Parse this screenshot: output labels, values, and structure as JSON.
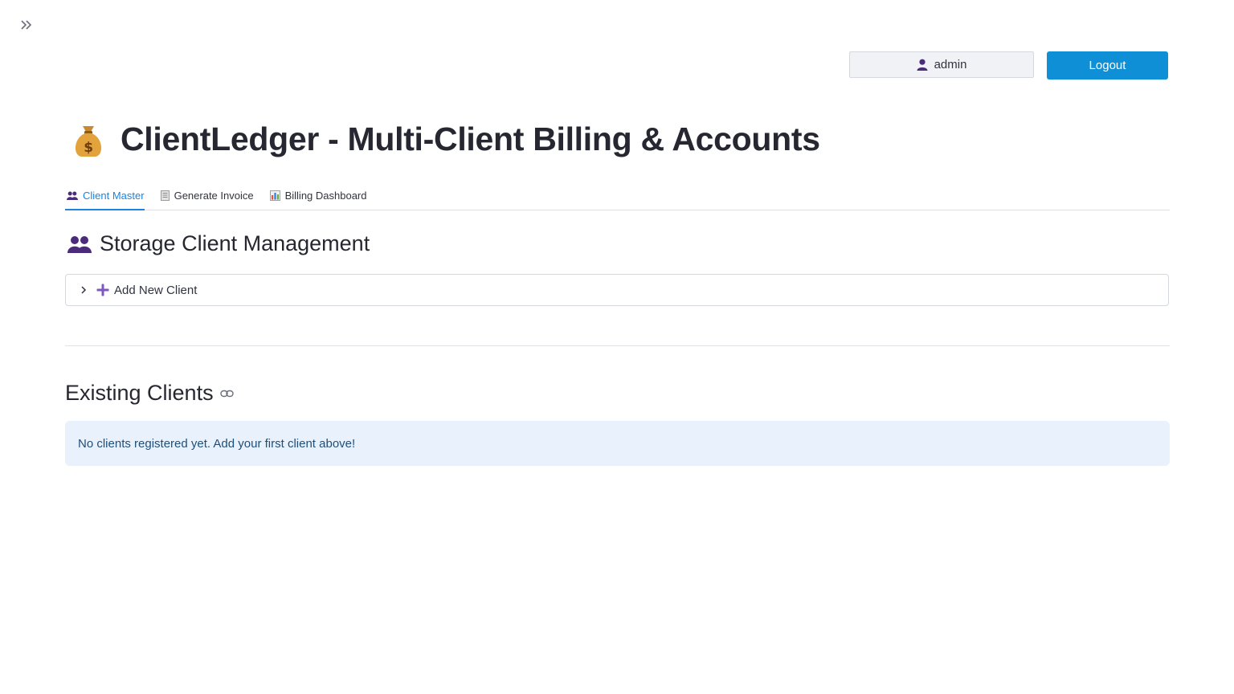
{
  "header": {
    "user": {
      "icon": "user-icon",
      "username": "admin"
    },
    "logout_label": "Logout"
  },
  "page": {
    "title_icon": "money-bag-icon",
    "title": "ClientLedger - Multi-Client Billing & Accounts"
  },
  "tabs": [
    {
      "icon": "people-icon",
      "label": "Client Master",
      "active": true
    },
    {
      "icon": "document-icon",
      "label": "Generate Invoice",
      "active": false
    },
    {
      "icon": "bar-chart-icon",
      "label": "Billing Dashboard",
      "active": false
    }
  ],
  "client_management": {
    "icon": "people-icon",
    "title": "Storage Client Management",
    "expander": {
      "icon": "plus-icon",
      "label": "Add New Client",
      "expanded": false
    }
  },
  "existing_clients": {
    "title": "Existing Clients",
    "link_icon": "link-icon",
    "info_message": "No clients registered yet. Add your first client above!"
  },
  "colors": {
    "accent": "#1c83e1",
    "button": "#0f8fd6",
    "info_bg": "#e8f1fc",
    "info_text": "#1e4f7a",
    "icon_purple": "#4a2c7a"
  }
}
